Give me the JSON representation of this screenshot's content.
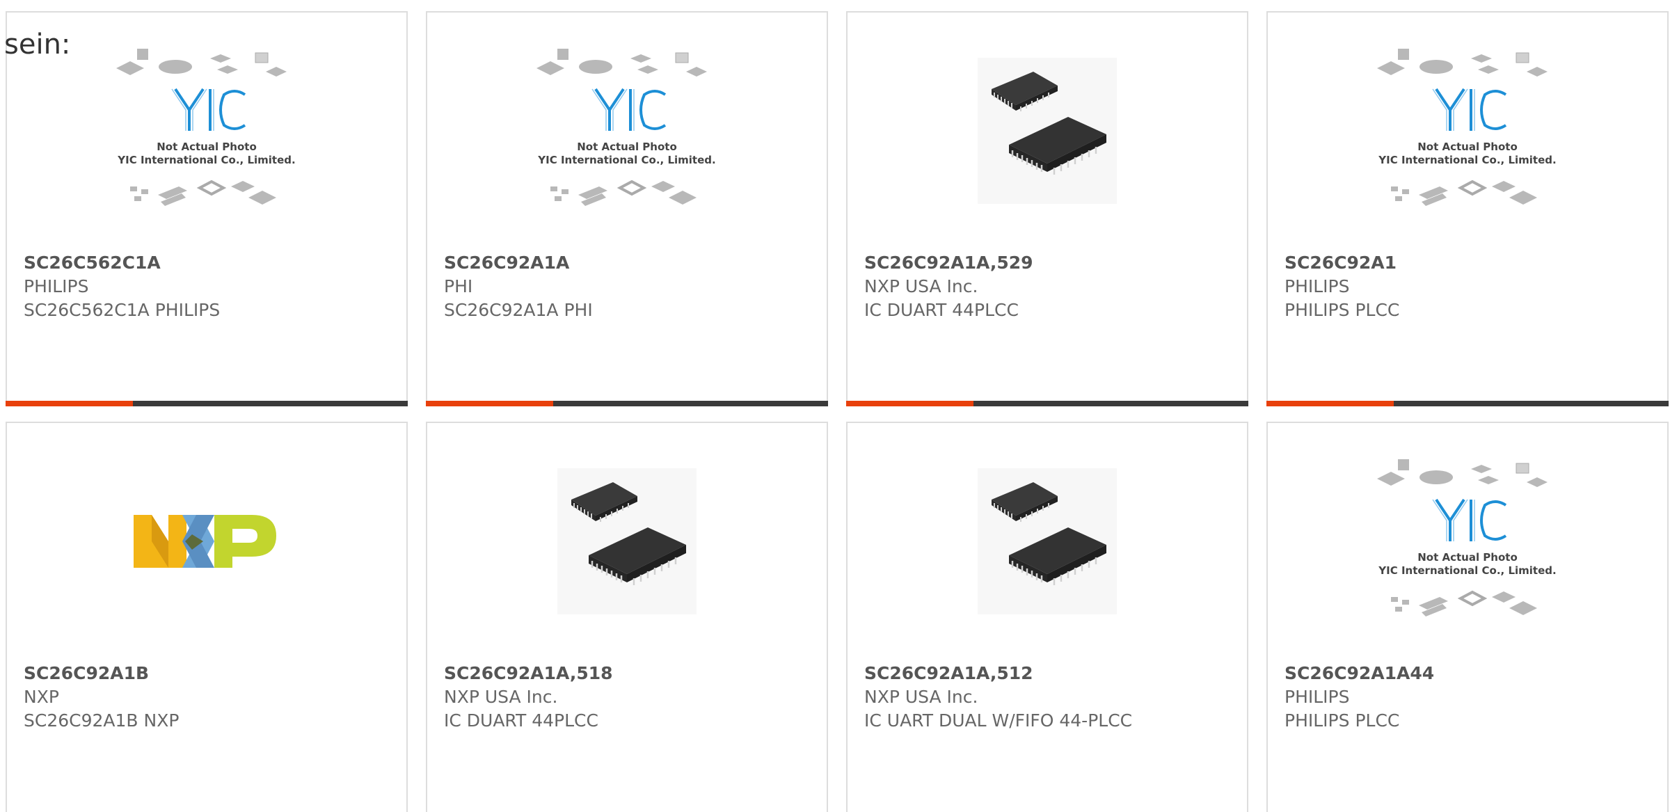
{
  "prefix_text": "sein:",
  "colors": {
    "accent_bar": "#e8400c",
    "dark_bar": "#3a3a3a",
    "card_border": "#dddddd",
    "text": "#666666",
    "yic_blue": "#1d8fd6",
    "nxp_yellow": "#f3b516",
    "nxp_blue": "#6fa8d8",
    "nxp_green": "#c2d52e"
  },
  "placeholder_image": {
    "line1": "Not Actual Photo",
    "line2": "YIC International Co., Limited.",
    "logo": "YIC"
  },
  "cards": [
    {
      "part": "SC26C562C1A",
      "manufacturer": "PHILIPS",
      "description": "SC26C562C1A PHILIPS",
      "image": "yic-placeholder",
      "bar": true
    },
    {
      "part": "SC26C92A1A",
      "manufacturer": "PHI",
      "description": "SC26C92A1A PHI",
      "image": "yic-placeholder",
      "bar": true
    },
    {
      "part": "SC26C92A1A,529",
      "manufacturer": "NXP USA Inc.",
      "description": "IC DUART 44PLCC",
      "image": "plcc-chip",
      "bar": true
    },
    {
      "part": "SC26C92A1",
      "manufacturer": "PHILIPS",
      "description": "PHILIPS PLCC",
      "image": "yic-placeholder",
      "bar": true
    },
    {
      "part": "SC26C92A1B",
      "manufacturer": "NXP",
      "description": "SC26C92A1B NXP",
      "image": "nxp-logo",
      "bar": false
    },
    {
      "part": "SC26C92A1A,518",
      "manufacturer": "NXP USA Inc.",
      "description": "IC DUART 44PLCC",
      "image": "plcc-chip",
      "bar": false
    },
    {
      "part": "SC26C92A1A,512",
      "manufacturer": "NXP USA Inc.",
      "description": "IC UART DUAL W/FIFO 44-PLCC",
      "image": "plcc-chip",
      "bar": false
    },
    {
      "part": "SC26C92A1A44",
      "manufacturer": "PHILIPS",
      "description": "PHILIPS PLCC",
      "image": "yic-placeholder",
      "bar": false
    }
  ]
}
